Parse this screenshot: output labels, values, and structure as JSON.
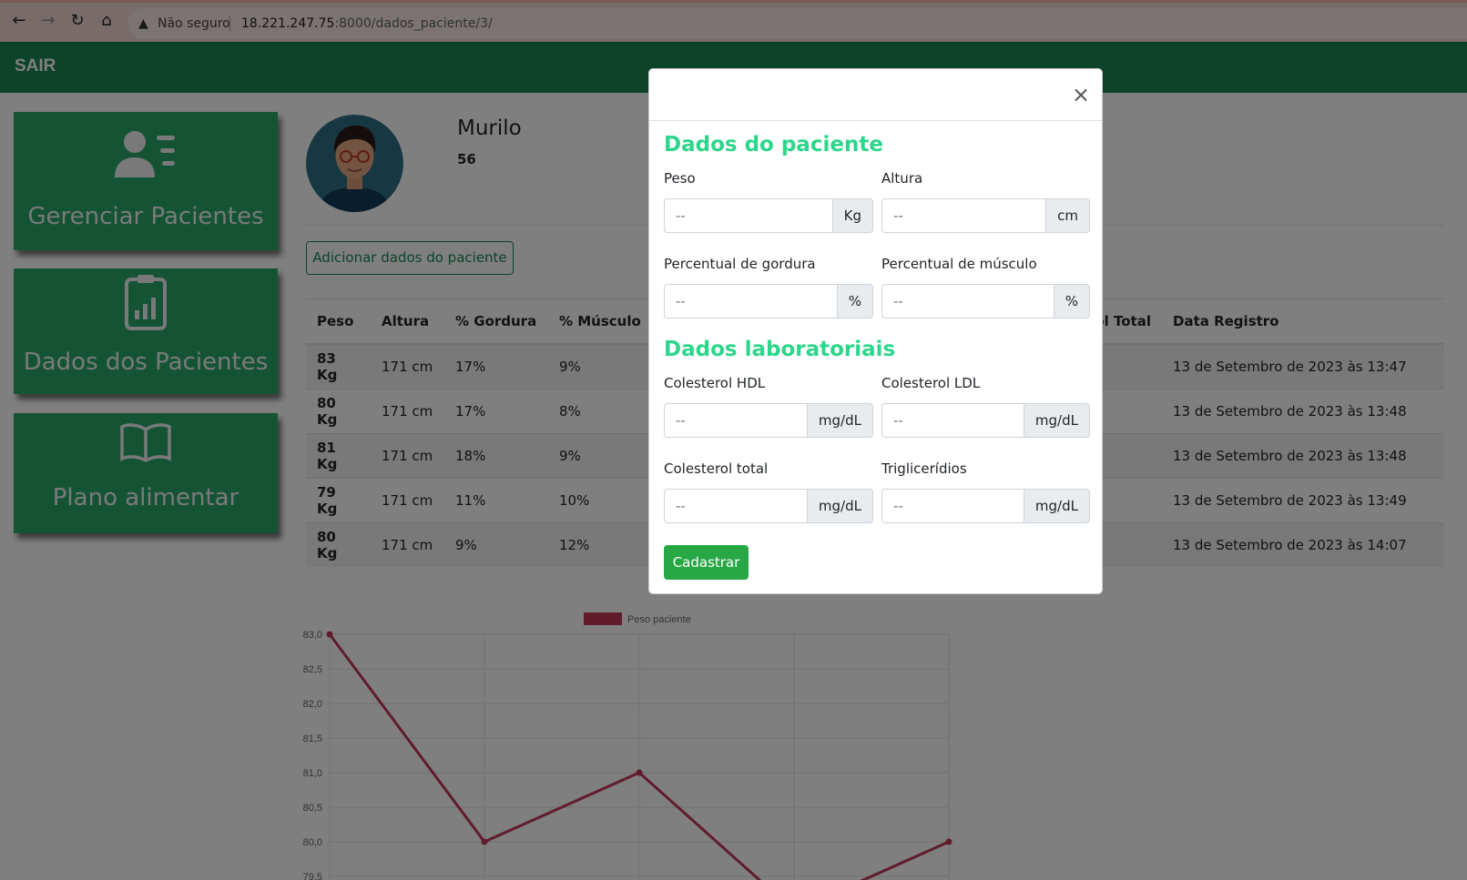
{
  "browser": {
    "insecure_label": "Não seguro",
    "url_host": "18.221.247.75",
    "url_rest": ":8000/dados_paciente/3/"
  },
  "nav": {
    "sair": "SAIR",
    "color": "#198754"
  },
  "sidebar": [
    {
      "label": "Gerenciar Pacientes",
      "icon": "user-list-icon"
    },
    {
      "label": "Dados dos Pacientes",
      "icon": "clipboard-chart-icon"
    },
    {
      "label": "Plano alimentar",
      "icon": "book-icon"
    }
  ],
  "patient": {
    "name": "Murilo",
    "age": "56"
  },
  "add_button": "Adicionar dados do paciente",
  "table": {
    "headers": [
      "Peso",
      "Altura",
      "% Gordura",
      "% Músculo",
      "",
      "",
      "",
      "erol Total",
      "Data Registro"
    ],
    "rows": [
      [
        "83 Kg",
        "171 cm",
        "17%",
        "9%",
        "13 de Setembro de 2023 às 13:47"
      ],
      [
        "80 Kg",
        "171 cm",
        "17%",
        "8%",
        "13 de Setembro de 2023 às 13:48"
      ],
      [
        "81 Kg",
        "171 cm",
        "18%",
        "9%",
        "13 de Setembro de 2023 às 13:48"
      ],
      [
        "79 Kg",
        "171 cm",
        "11%",
        "10%",
        "13 de Setembro de 2023 às 13:49"
      ],
      [
        "80 Kg",
        "171 cm",
        "9%",
        "12%",
        "13 de Setembro de 2023 às 14:07"
      ]
    ]
  },
  "chart_data": {
    "type": "line",
    "series": [
      {
        "name": "Peso paciente",
        "values": [
          83,
          80,
          81,
          79,
          80
        ]
      }
    ],
    "ylim": [
      79.5,
      83.0
    ],
    "yticks": [
      "83,0",
      "82,5",
      "82,0",
      "81,5",
      "81,0",
      "80,5",
      "80,0",
      "79,5"
    ],
    "color": "#c0395a"
  },
  "modal": {
    "close": "×",
    "section1": "Dados do paciente",
    "section2": "Dados laboratoriais",
    "fields": {
      "peso": {
        "label": "Peso",
        "placeholder": "--",
        "unit": "Kg"
      },
      "altura": {
        "label": "Altura",
        "placeholder": "--",
        "unit": "cm"
      },
      "gordura": {
        "label": "Percentual de gordura",
        "placeholder": "--",
        "unit": "%"
      },
      "musculo": {
        "label": "Percentual de músculo",
        "placeholder": "--",
        "unit": "%"
      },
      "hdl": {
        "label": "Colesterol HDL",
        "placeholder": "--",
        "unit": "mg/dL"
      },
      "ldl": {
        "label": "Colesterol LDL",
        "placeholder": "--",
        "unit": "mg/dL"
      },
      "total": {
        "label": "Colesterol total",
        "placeholder": "--",
        "unit": "mg/dL"
      },
      "trig": {
        "label": "Triglicerídios",
        "placeholder": "--",
        "unit": "mg/dL"
      }
    },
    "submit": "Cadastrar"
  }
}
